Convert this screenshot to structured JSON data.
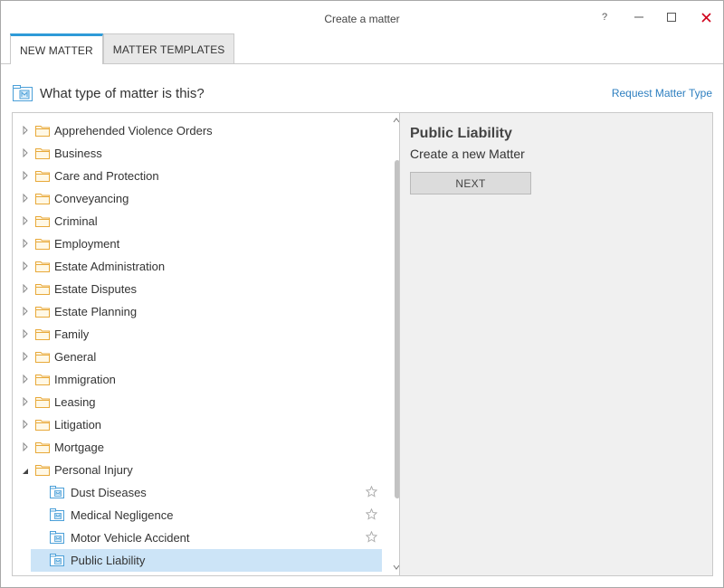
{
  "window": {
    "title": "Create a matter",
    "help_glyph": "?",
    "minimize_glyph": "–",
    "maximize_glyph": "☐",
    "close_glyph": "✕"
  },
  "tabs": [
    {
      "label": "NEW MATTER",
      "active": true
    },
    {
      "label": "MATTER TEMPLATES",
      "active": false
    }
  ],
  "header": {
    "question": "What type of matter is this?",
    "request_link": "Request Matter Type",
    "icon": "matter-icon"
  },
  "tree": {
    "categories": [
      {
        "label": "Apprehended Violence Orders",
        "expanded": false
      },
      {
        "label": "Business",
        "expanded": false
      },
      {
        "label": "Care and Protection",
        "expanded": false
      },
      {
        "label": "Conveyancing",
        "expanded": false
      },
      {
        "label": "Criminal",
        "expanded": false
      },
      {
        "label": "Employment",
        "expanded": false
      },
      {
        "label": "Estate Administration",
        "expanded": false
      },
      {
        "label": "Estate Disputes",
        "expanded": false
      },
      {
        "label": "Estate Planning",
        "expanded": false
      },
      {
        "label": "Family",
        "expanded": false
      },
      {
        "label": "General",
        "expanded": false
      },
      {
        "label": "Immigration",
        "expanded": false
      },
      {
        "label": "Leasing",
        "expanded": false
      },
      {
        "label": "Litigation",
        "expanded": false
      },
      {
        "label": "Mortgage",
        "expanded": false
      },
      {
        "label": "Personal Injury",
        "expanded": true
      }
    ],
    "children": [
      {
        "label": "Dust Diseases",
        "selected": false,
        "favorite_icon": "star-outline-icon"
      },
      {
        "label": "Medical Negligence",
        "selected": false,
        "favorite_icon": "star-outline-icon"
      },
      {
        "label": "Motor Vehicle Accident",
        "selected": false,
        "favorite_icon": "star-outline-icon"
      },
      {
        "label": "Public Liability",
        "selected": true,
        "favorite_icon": ""
      }
    ]
  },
  "detail": {
    "title": "Public Liability",
    "subtitle": "Create a new Matter",
    "next_label": "NEXT"
  },
  "colors": {
    "accent": "#2e9bd8",
    "link": "#2e7fc0",
    "folder": "#e8a93a",
    "selected_row": "#cce4f7",
    "close": "#d0021b"
  }
}
